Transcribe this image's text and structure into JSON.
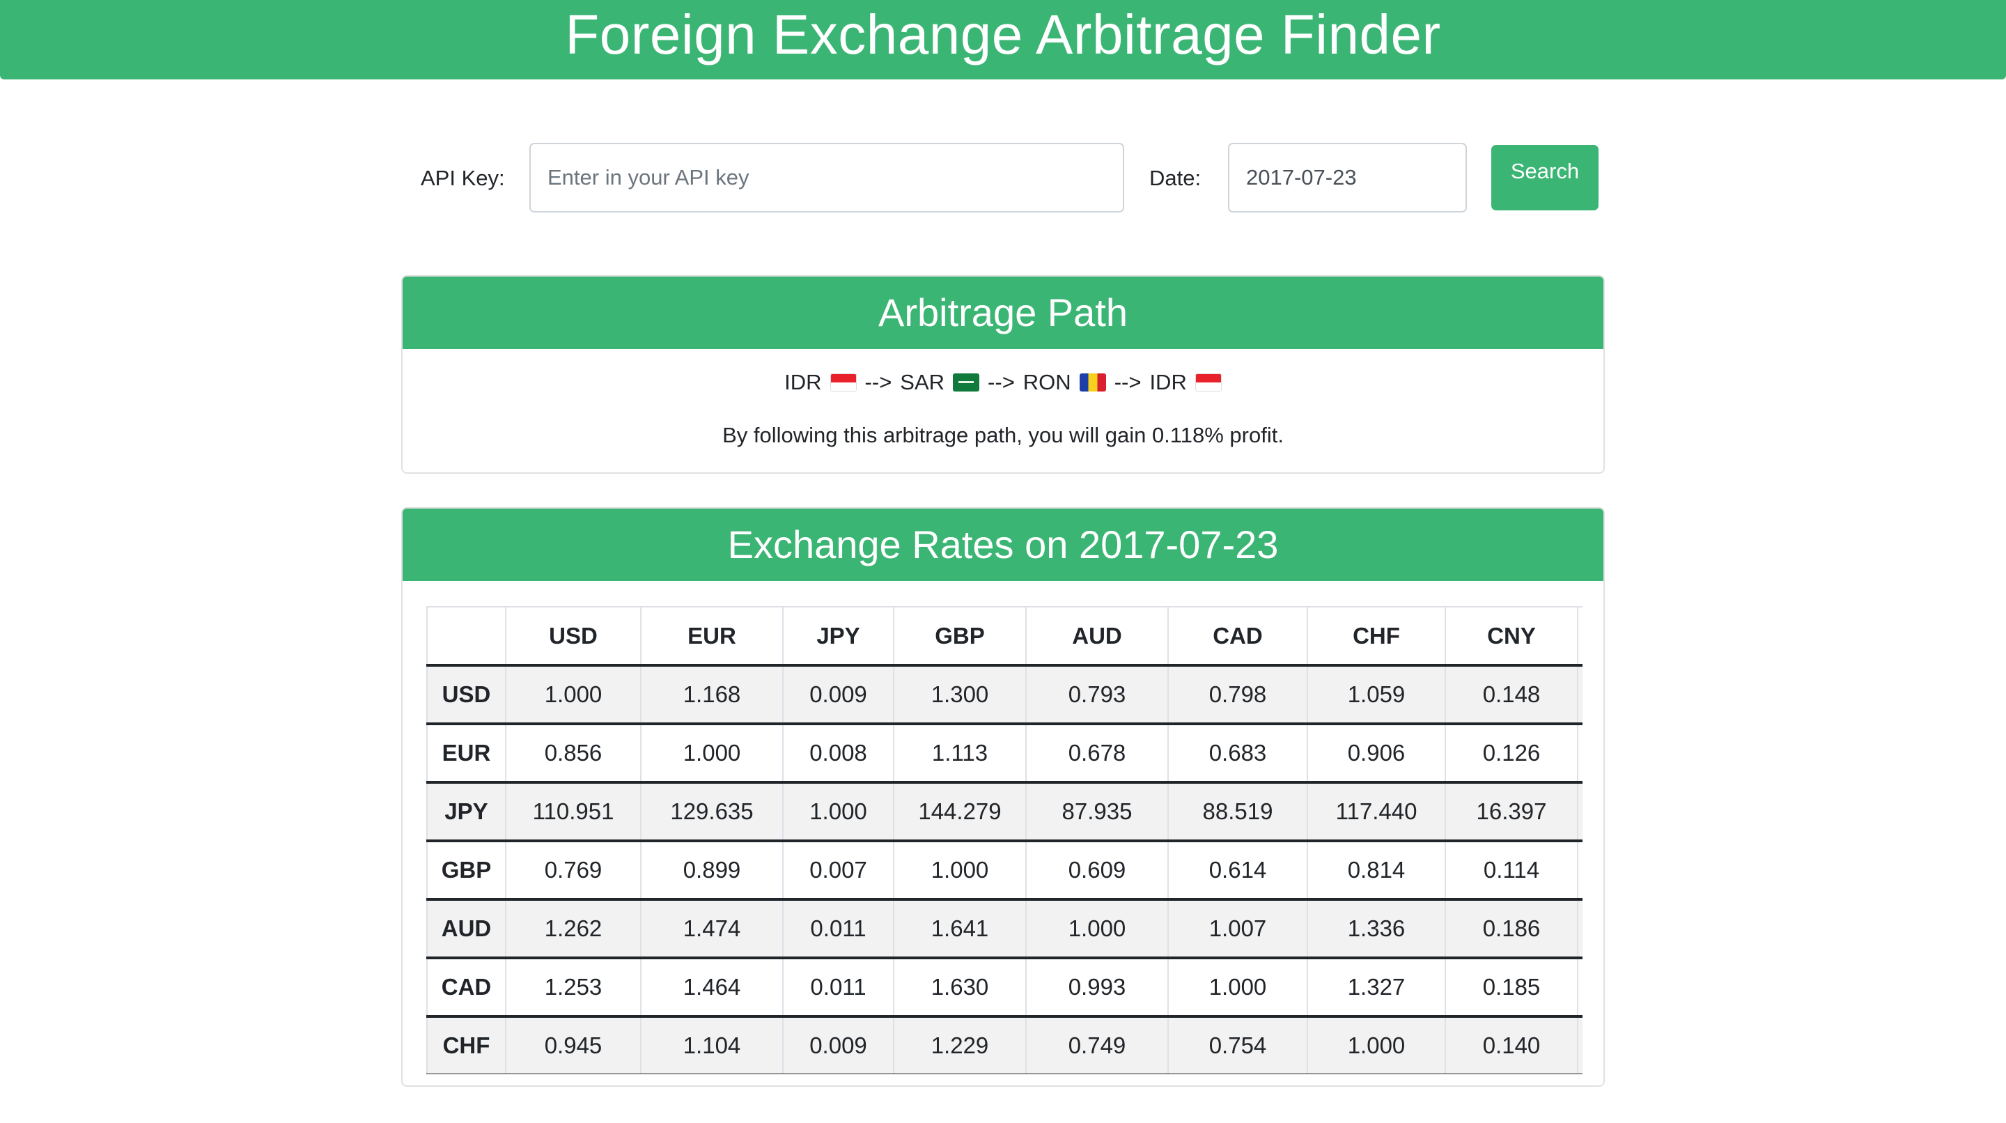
{
  "app": {
    "title": "Foreign Exchange Arbitrage Finder"
  },
  "form": {
    "api_label": "API Key:",
    "api_placeholder": "Enter in your API key",
    "api_value": "",
    "date_label": "Date:",
    "date_value": "2017-07-23",
    "search_label": "Search"
  },
  "path_card": {
    "title": "Arbitrage Path",
    "steps": [
      {
        "code": "IDR",
        "flag": "flag-indonesia-icon"
      },
      {
        "arrow": "-->"
      },
      {
        "code": "SAR",
        "flag": "flag-saudi-arabia-icon"
      },
      {
        "arrow": "-->"
      },
      {
        "code": "RON",
        "flag": "flag-romania-icon"
      },
      {
        "arrow": "-->"
      },
      {
        "code": "IDR",
        "flag": "flag-indonesia-icon"
      }
    ],
    "profit_text": "By following this arbitrage path, you will gain 0.118% profit."
  },
  "rates_card": {
    "title": "Exchange Rates on 2017-07-23",
    "columns": [
      "",
      "USD",
      "EUR",
      "JPY",
      "GBP",
      "AUD",
      "CAD",
      "CHF",
      "CNY",
      ""
    ],
    "rows": [
      {
        "label": "USD",
        "values": [
          "1.000",
          "1.168",
          "0.009",
          "1.300",
          "0.793",
          "0.798",
          "1.059",
          "0.148",
          ""
        ]
      },
      {
        "label": "EUR",
        "values": [
          "0.856",
          "1.000",
          "0.008",
          "1.113",
          "0.678",
          "0.683",
          "0.906",
          "0.126",
          ""
        ]
      },
      {
        "label": "JPY",
        "values": [
          "110.951",
          "129.635",
          "1.000",
          "144.279",
          "87.935",
          "88.519",
          "117.440",
          "16.397",
          ""
        ]
      },
      {
        "label": "GBP",
        "values": [
          "0.769",
          "0.899",
          "0.007",
          "1.000",
          "0.609",
          "0.614",
          "0.814",
          "0.114",
          ""
        ]
      },
      {
        "label": "AUD",
        "values": [
          "1.262",
          "1.474",
          "0.011",
          "1.641",
          "1.000",
          "1.007",
          "1.336",
          "0.186",
          ""
        ]
      },
      {
        "label": "CAD",
        "values": [
          "1.253",
          "1.464",
          "0.011",
          "1.630",
          "0.993",
          "1.000",
          "1.327",
          "0.185",
          ""
        ]
      },
      {
        "label": "CHF",
        "values": [
          "0.945",
          "1.104",
          "0.009",
          "1.229",
          "0.749",
          "0.754",
          "1.000",
          "0.140",
          ""
        ]
      }
    ]
  }
}
